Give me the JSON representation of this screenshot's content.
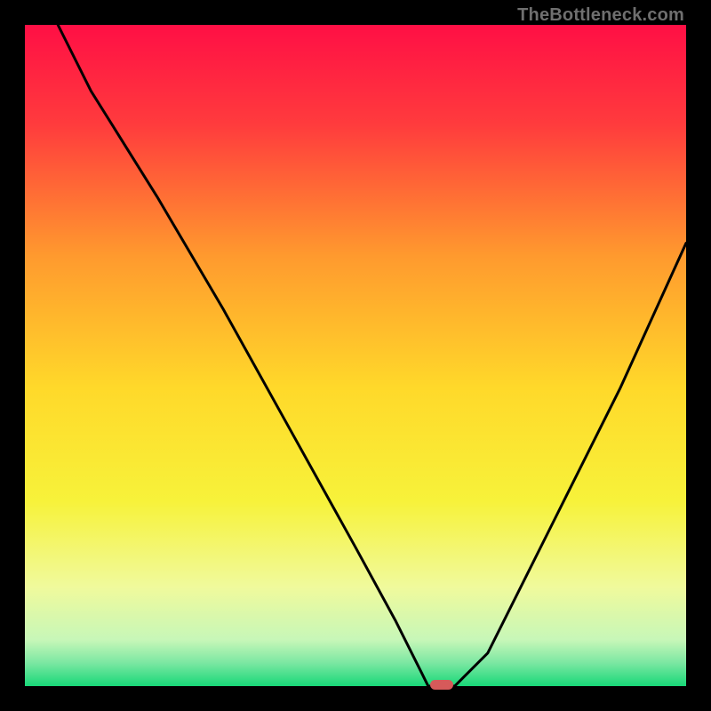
{
  "watermark": "TheBottleneck.com",
  "chart_data": {
    "type": "line",
    "title": "",
    "xlabel": "",
    "ylabel": "",
    "xlim": [
      0,
      100
    ],
    "ylim": [
      0,
      100
    ],
    "axes_visible": false,
    "grid": false,
    "background_gradient": {
      "stops": [
        {
          "pos": 0.0,
          "color": "#ff0f45"
        },
        {
          "pos": 0.15,
          "color": "#ff3b3d"
        },
        {
          "pos": 0.35,
          "color": "#ff9a2e"
        },
        {
          "pos": 0.55,
          "color": "#ffd92a"
        },
        {
          "pos": 0.72,
          "color": "#f7f23a"
        },
        {
          "pos": 0.85,
          "color": "#f0fa9c"
        },
        {
          "pos": 0.93,
          "color": "#c7f7b8"
        },
        {
          "pos": 0.965,
          "color": "#7be7a2"
        },
        {
          "pos": 1.0,
          "color": "#18d878"
        }
      ]
    },
    "series": [
      {
        "name": "bottleneck-curve",
        "color": "#000000",
        "x": [
          5,
          10,
          20,
          30,
          40,
          50,
          56,
          60,
          61,
          65,
          70,
          80,
          90,
          100
        ],
        "y": [
          100,
          90,
          74,
          57,
          39,
          21,
          10,
          2,
          0,
          0,
          5,
          25,
          45,
          67
        ]
      }
    ],
    "marker": {
      "name": "optimal-pill",
      "color": "#d65a5a",
      "x": 63,
      "y": 0
    }
  }
}
